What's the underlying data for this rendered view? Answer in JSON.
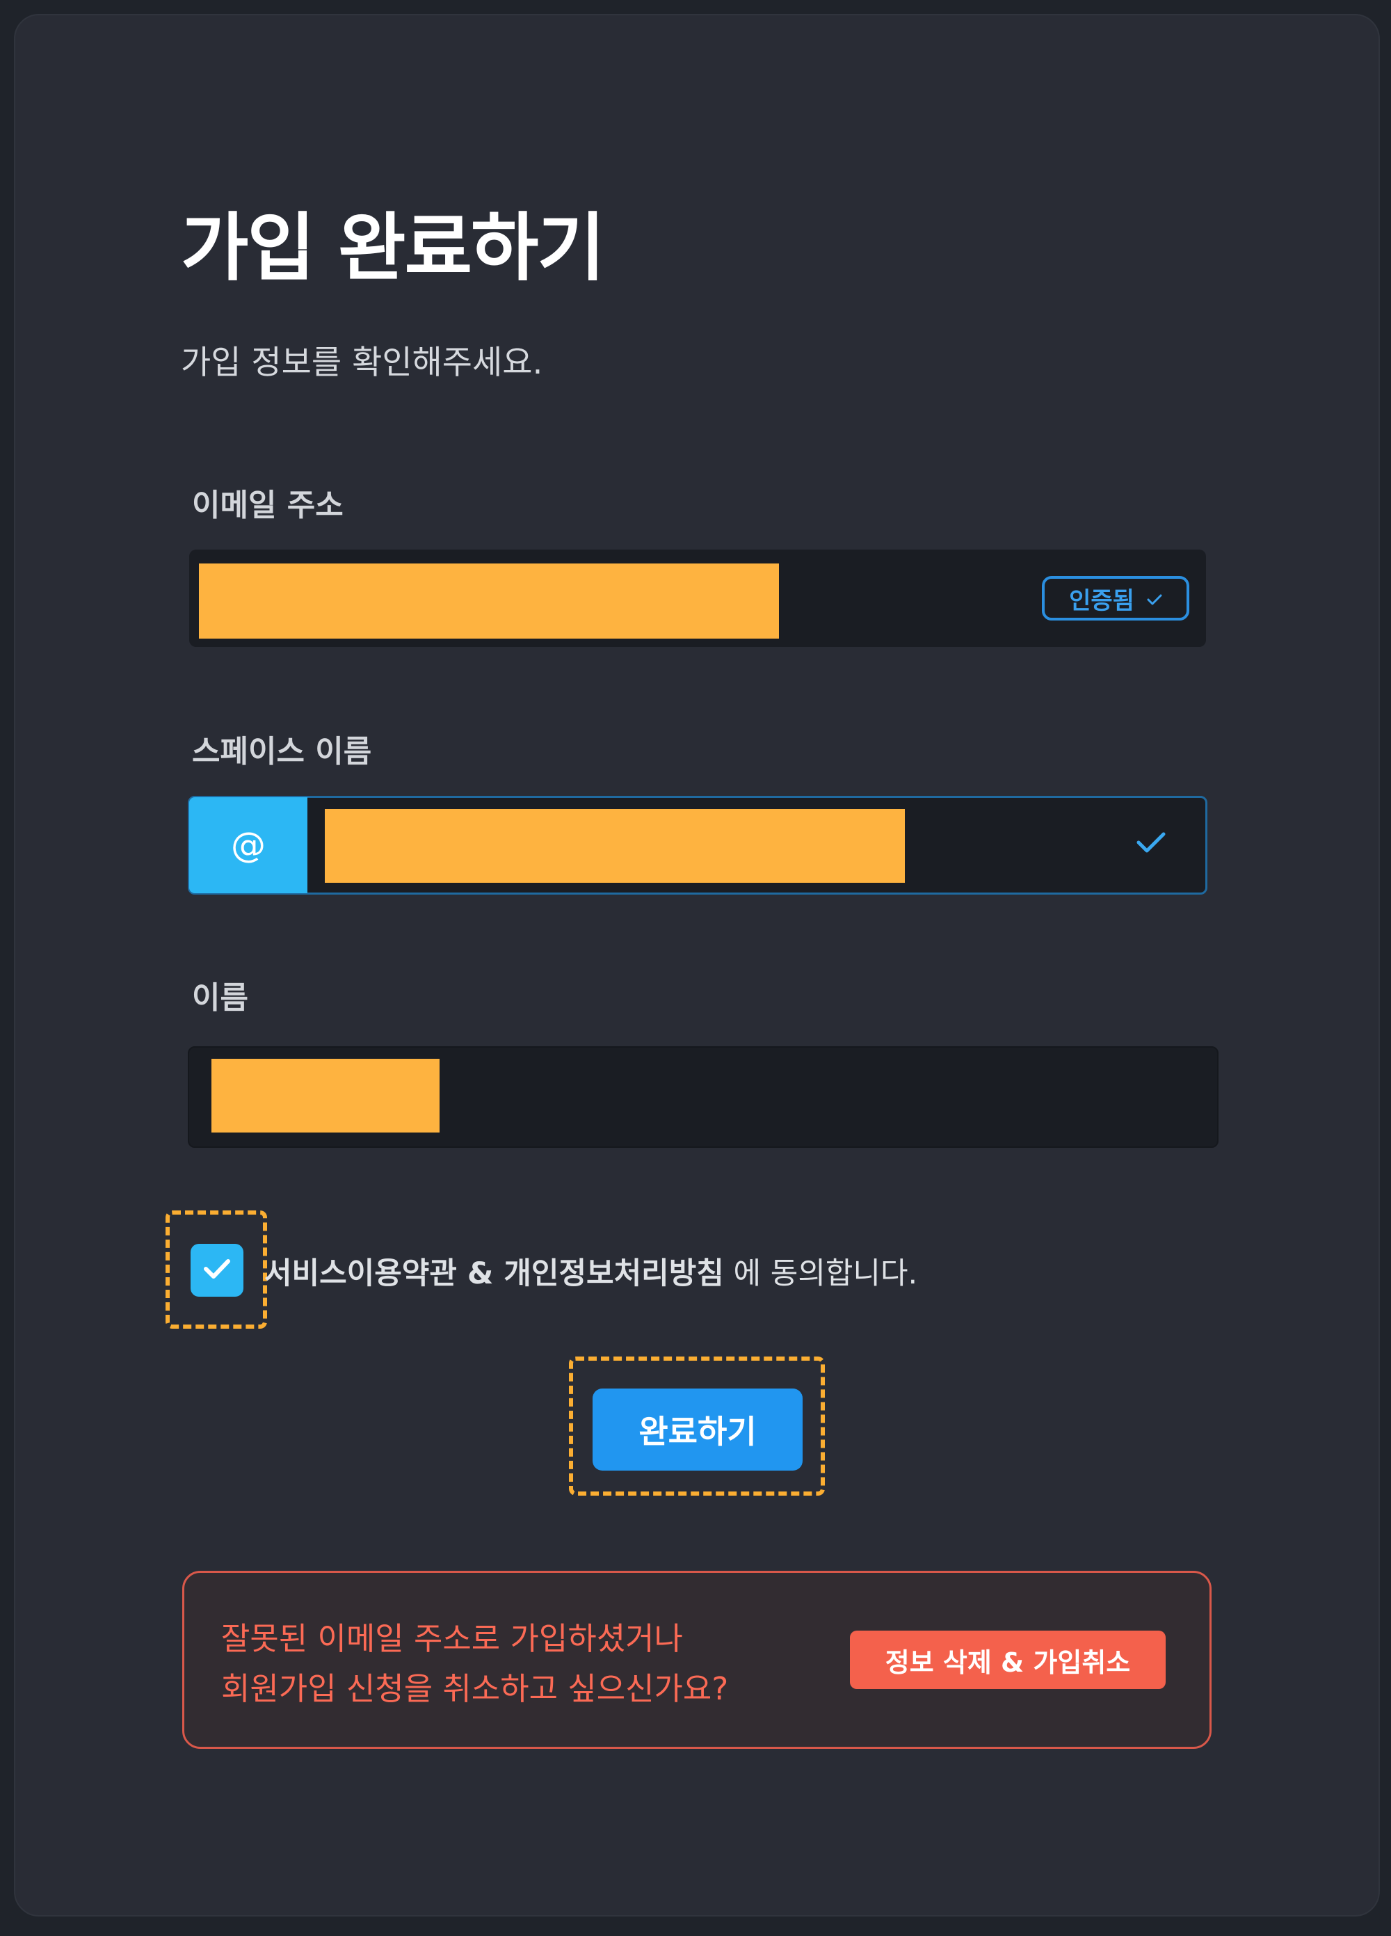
{
  "page": {
    "title": "가입 완료하기",
    "subtitle": "가입 정보를 확인해주세요."
  },
  "email": {
    "label": "이메일 주소",
    "badge": "인증됨"
  },
  "space": {
    "label": "스페이스 이름",
    "prefix": "@"
  },
  "name": {
    "label": "이름"
  },
  "agreement": {
    "checked": true,
    "terms_link": "서비스이용약관",
    "amp": " & ",
    "privacy_link": "개인정보처리방침",
    "suffix": " 에 동의합니다."
  },
  "submit": {
    "label": "완료하기"
  },
  "cancel": {
    "line1": "잘못된 이메일 주소로 가입하셨거나",
    "line2": "회원가입 신청을 취소하고 싶으신가요?",
    "button": "정보 삭제 & 가입취소"
  },
  "colors": {
    "accent": "#2cb7f4",
    "primary_button": "#2196f0",
    "danger": "#f4614c",
    "highlight": "#fbae32"
  }
}
